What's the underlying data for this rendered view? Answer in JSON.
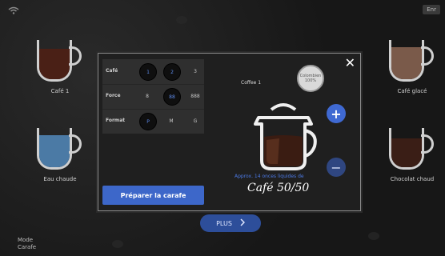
{
  "app": {
    "wifi_icon": "wifi-icon",
    "top_right_label": "Enr"
  },
  "background_items": [
    {
      "label": "Café 1",
      "fill": "#4a2016"
    },
    {
      "label": "Café glacé",
      "fill": "#7a5a4a"
    },
    {
      "label": "Eau chaude",
      "fill": "#4b7aa5"
    },
    {
      "label": "Chocolat chaud",
      "fill": "#3a1e16"
    }
  ],
  "mode": {
    "line1": "Mode",
    "line2": "Carafe"
  },
  "footer": {
    "plus_label": "PLUS",
    "plus_icon": "chevron-right-icon"
  },
  "modal": {
    "close_icon": "close-icon",
    "selection_caption": "Coffee 1",
    "badge": {
      "line1": "Colombien",
      "line2": "100%"
    },
    "options": [
      {
        "label": "Café",
        "values": [
          "1",
          "2",
          "3"
        ],
        "selected": [
          "1",
          "2"
        ]
      },
      {
        "label": "Force",
        "values": [
          "8",
          "88",
          "888"
        ],
        "selected": [
          "88"
        ]
      },
      {
        "label": "Format",
        "values": [
          "P",
          "M",
          "G"
        ],
        "selected": [
          "P"
        ]
      }
    ],
    "prepare_button": "Préparer la carafe",
    "increment_icon": "plus-icon",
    "decrement_icon": "minus-icon",
    "approx_text": "Approx. 14 onces liquides de",
    "quantity_text": "Café 50/50"
  },
  "colors": {
    "accent": "#3d67c9",
    "selected_value": "#5d8ae8"
  }
}
